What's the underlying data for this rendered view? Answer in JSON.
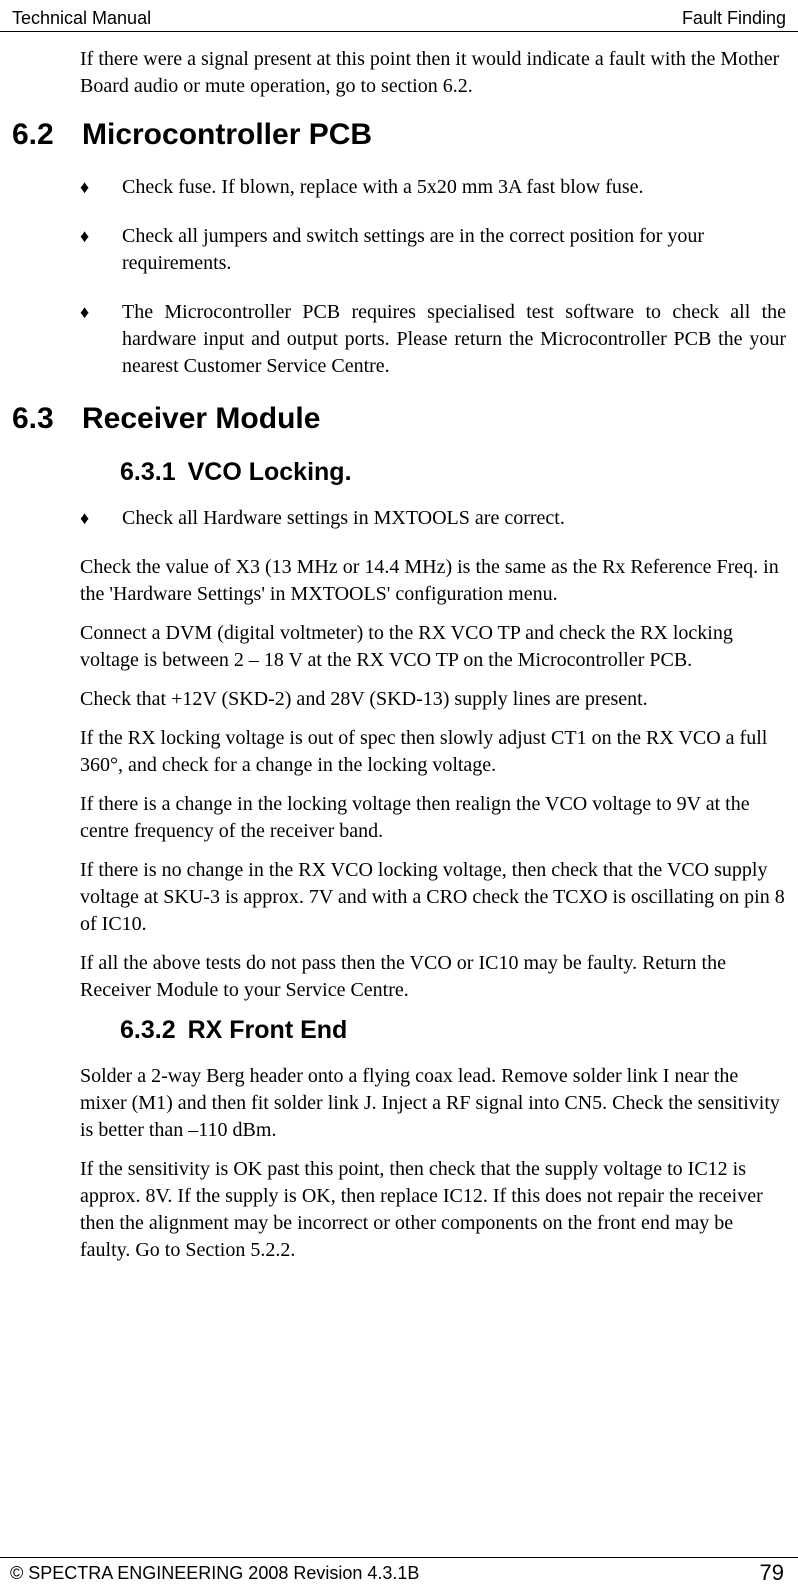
{
  "header": {
    "left": "Technical Manual",
    "right": "Fault Finding"
  },
  "intro_para": "If there were a signal present at this point then it would indicate a fault with the Mother Board audio or mute operation, go to section 6.2.",
  "s62": {
    "num": "6.2",
    "title": "Microcontroller PCB",
    "bullets": [
      "Check fuse. If blown, replace with a 5x20 mm 3A fast blow fuse.",
      "Check all jumpers and switch settings are in the correct position for your requirements.",
      "The Microcontroller PCB requires specialised test software to check all the hardware input and output ports. Please return the Microcontroller PCB the your nearest Customer Service Centre."
    ]
  },
  "s63": {
    "num": "6.3",
    "title": "Receiver Module",
    "s631": {
      "num": "6.3.1",
      "title": "VCO Locking.",
      "bullet": "Check all Hardware settings in MXTOOLS are correct.",
      "paras": [
        "Check the value of X3 (13 MHz or 14.4 MHz) is the same as the Rx Reference Freq. in the 'Hardware Settings' in MXTOOLS' configuration menu.",
        "Connect a DVM (digital voltmeter) to the RX VCO TP and check the RX locking voltage is between 2 – 18 V at the RX VCO TP on the Microcontroller PCB.",
        "Check that +12V (SKD-2) and 28V (SKD-13) supply lines are present.",
        "If the RX locking voltage is out of spec then slowly adjust CT1 on the RX VCO a full 360°, and check for a change in the locking voltage.",
        "If there is a change in the locking voltage then realign the VCO voltage to 9V at the centre frequency of the receiver band.",
        "If there is no change in the RX VCO locking voltage, then check that the VCO supply voltage at SKU-3 is approx. 7V and with a CRO check the TCXO is oscillating on pin 8 of IC10.",
        "If all the above tests do not pass then the VCO or IC10 may be faulty. Return the Receiver Module to your Service Centre."
      ]
    },
    "s632": {
      "num": "6.3.2",
      "title": "RX Front End",
      "paras": [
        "Solder a 2-way Berg header onto a flying coax lead. Remove solder link I near the mixer (M1) and then fit solder link J. Inject a RF signal into CN5. Check the sensitivity is better than –110 dBm.",
        "If the sensitivity is OK past this point, then check that the supply voltage to IC12 is approx. 8V. If the supply is OK, then replace IC12. If this does not repair the receiver then the alignment may be incorrect or other components on the front end may be faulty. Go to Section 5.2.2."
      ]
    }
  },
  "footer": {
    "left": "© SPECTRA ENGINEERING 2008 Revision 4.3.1B",
    "right": "79"
  },
  "marker": "♦"
}
